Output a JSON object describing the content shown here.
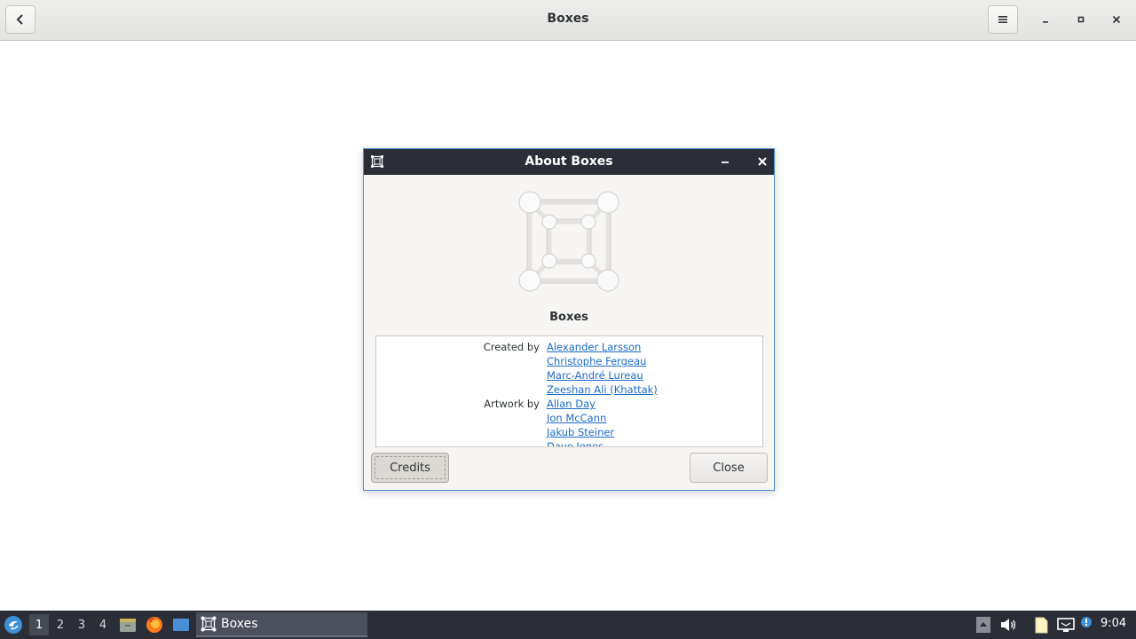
{
  "window": {
    "title": "Boxes",
    "buttons": {
      "back_icon": "chevron-left-icon",
      "menu_icon": "hamburger-menu-icon",
      "minimize_icon": "minimize-icon",
      "maximize_icon": "maximize-icon",
      "close_icon": "close-icon"
    }
  },
  "dialog": {
    "title": "About Boxes",
    "app_name": "Boxes",
    "credits": [
      {
        "label": "Created by",
        "names": [
          "Alexander Larsson",
          "Christophe Fergeau",
          "Marc-André Lureau",
          "Zeeshan Ali (Khattak)"
        ]
      },
      {
        "label": "Artwork by",
        "names": [
          "Allan Day",
          "Jon McCann",
          "Jakub Steiner",
          "Dave Jones"
        ]
      }
    ],
    "credits_button": "Credits",
    "close_button": "Close"
  },
  "taskbar": {
    "workspaces": [
      "1",
      "2",
      "3",
      "4"
    ],
    "active_workspace": "1",
    "task_label": "Boxes",
    "clock": "9:04"
  },
  "colors": {
    "accent": "#4a90d9",
    "panel": "#2b2e37",
    "link": "#1b6acb"
  }
}
